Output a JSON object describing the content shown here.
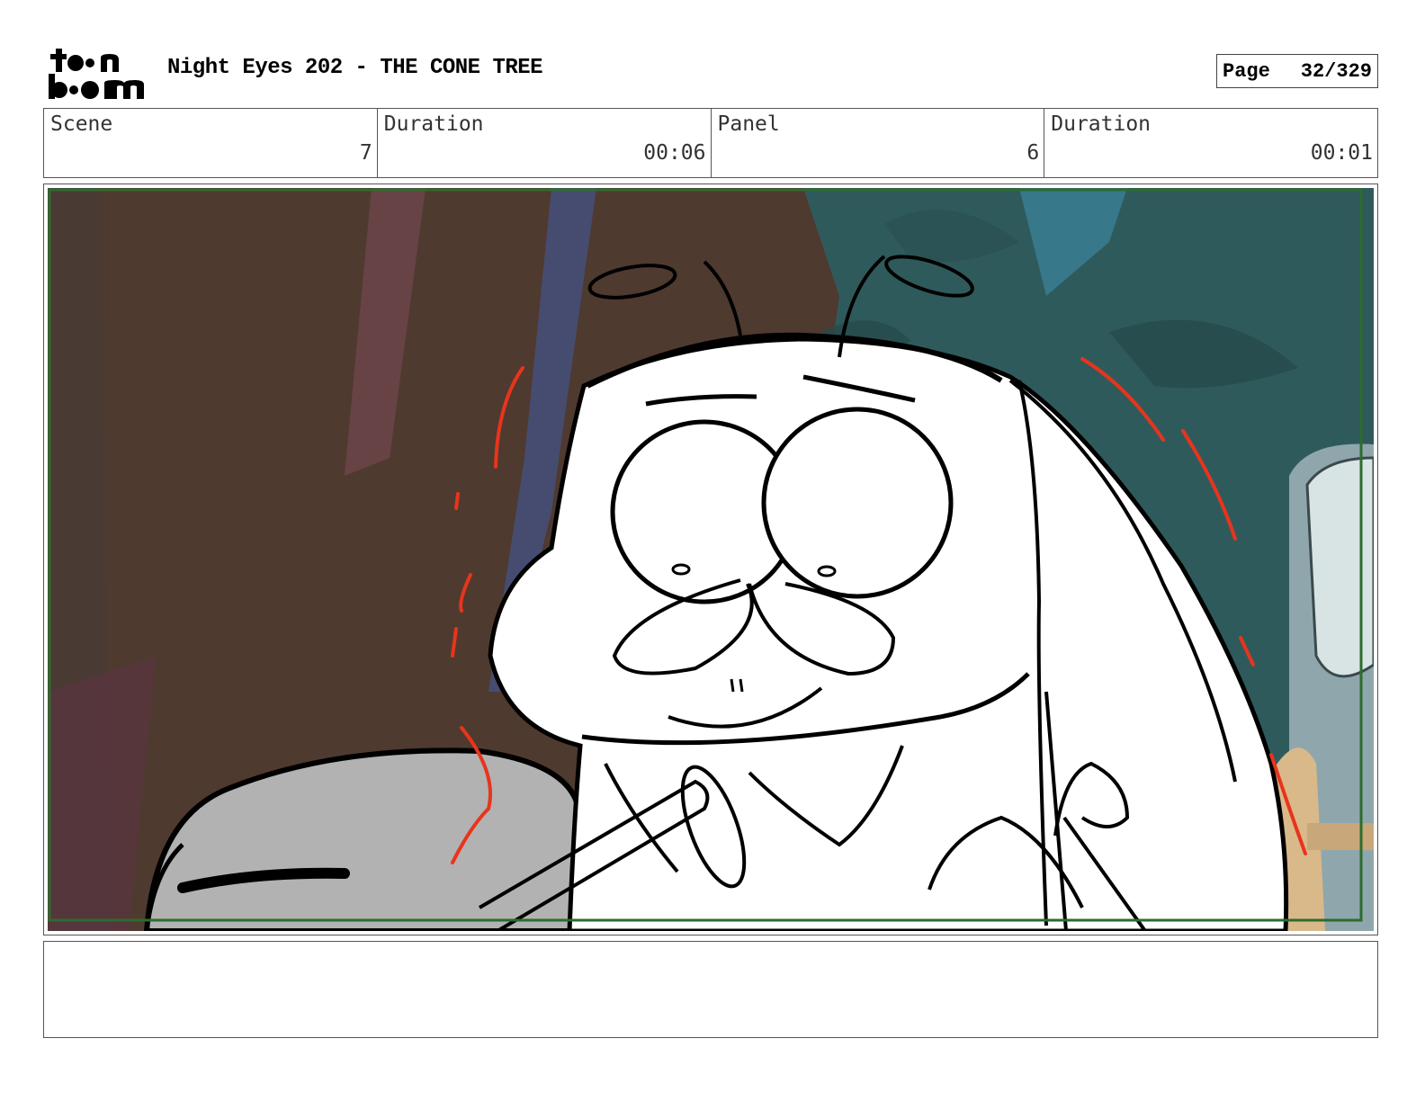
{
  "header": {
    "logo": "toon boom",
    "title": "Night Eyes 202 - THE CONE TREE",
    "page_label": "Page",
    "page_number": "32/329"
  },
  "info": {
    "scene_label": "Scene",
    "scene_value": "7",
    "scene_duration_label": "Duration",
    "scene_duration_value": "00:06",
    "panel_label": "Panel",
    "panel_value": "6",
    "panel_duration_label": "Duration",
    "panel_duration_value": "00:01"
  },
  "panel": {
    "frame_color": "#2e6b2e",
    "accent_lines_color": "#e8341c"
  },
  "notes": {
    "text": ""
  }
}
